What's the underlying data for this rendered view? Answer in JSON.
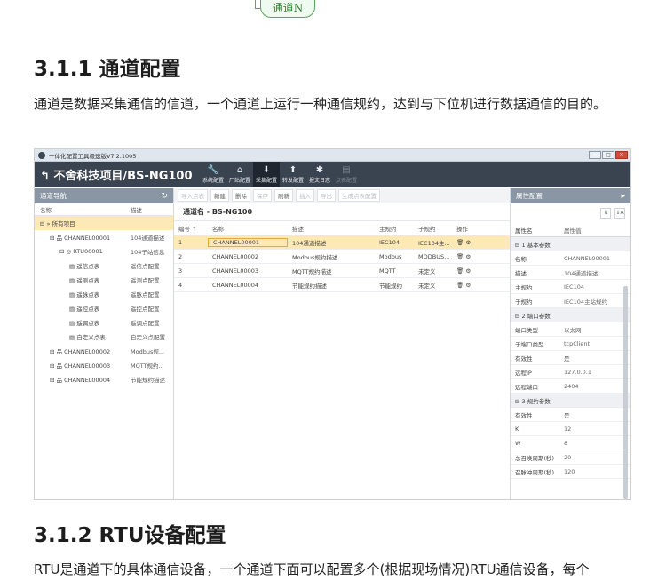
{
  "top_pill": "通道N",
  "sections": {
    "s1_heading": "3.1.1 通道配置",
    "s1_text": "通道是数据采集通信的信道，一个通道上运行一种通信规约，达到与下位机进行数据通信的目的。",
    "s2_heading": "3.1.2 RTU设备配置",
    "s2_text": "RTU是通道下的具体通信设备，一个通道下面可以配置多个(根据现场情况)RTU通信设备，每个"
  },
  "app": {
    "window_title": "一体化配置工具极速版V7.2.1005",
    "project_title": "不舍科技项目/BS-NG100",
    "toolbar": [
      {
        "icon": "wrench-icon",
        "glyph": "🔧",
        "label": "系统配置"
      },
      {
        "icon": "home-icon",
        "glyph": "⌂",
        "label": "厂站配置"
      },
      {
        "icon": "download-icon",
        "glyph": "⬇",
        "label": "采集配置"
      },
      {
        "icon": "upload-icon",
        "glyph": "⬆",
        "label": "转发配置"
      },
      {
        "icon": "bug-icon",
        "glyph": "✱",
        "label": "报文日志"
      },
      {
        "icon": "document-icon",
        "glyph": "▤",
        "label": "点表配置"
      }
    ],
    "left": {
      "panel_title": "通道导航",
      "col_name": "名称",
      "col_desc": "描述",
      "items": [
        {
          "name": "所有项目",
          "desc": "",
          "level": 0
        },
        {
          "name": "CHANNEL00001",
          "desc": "104通道描述",
          "level": 1
        },
        {
          "name": "RTU00001",
          "desc": "104子站信息",
          "level": 2
        },
        {
          "name": "遥信点表",
          "desc": "遥信点配置",
          "level": 3
        },
        {
          "name": "遥测点表",
          "desc": "遥测点配置",
          "level": 3
        },
        {
          "name": "遥脉点表",
          "desc": "遥脉点配置",
          "level": 3
        },
        {
          "name": "遥控点表",
          "desc": "遥控点配置",
          "level": 3
        },
        {
          "name": "遥调点表",
          "desc": "遥调点配置",
          "level": 3
        },
        {
          "name": "自定义点表",
          "desc": "自定义点配置",
          "level": 3
        },
        {
          "name": "CHANNEL00002",
          "desc": "Modbus规...",
          "level": 1
        },
        {
          "name": "CHANNEL00003",
          "desc": "MQTT规约...",
          "level": 1
        },
        {
          "name": "CHANNEL00004",
          "desc": "节能规约描述",
          "level": 1
        }
      ]
    },
    "mid": {
      "tools": [
        "导入点表",
        "新建",
        "删除",
        "保存",
        "刷新",
        "插入",
        "导出",
        "生成点表配置"
      ],
      "channel_name": "通道名 - BS-NG100",
      "headers": [
        "编号 ↑",
        "名称",
        "描述",
        "主规约",
        "子规约",
        "操作"
      ],
      "rows": [
        [
          "1",
          "CHANNEL00001",
          "104通道描述",
          "IEC104",
          "IEC104主...",
          "🗑 ⚙"
        ],
        [
          "2",
          "CHANNEL00002",
          "Modbus规约描述",
          "Modbus",
          "MODBUS...",
          "🗑 ⚙"
        ],
        [
          "3",
          "CHANNEL00003",
          "MQTT规约描述",
          "MQTT",
          "未定义",
          "🗑 ⚙"
        ],
        [
          "4",
          "CHANNEL00004",
          "节能规约描述",
          "节能规约",
          "未定义",
          "🗑 ⚙"
        ]
      ]
    },
    "right": {
      "panel_title": "属性配置",
      "col_name": "属性名",
      "col_value": "属性值",
      "rows": [
        {
          "group": "1 基本参数"
        },
        {
          "k": "名称",
          "v": "CHANNEL00001"
        },
        {
          "k": "描述",
          "v": "104通道描述"
        },
        {
          "k": "主规约",
          "v": "IEC104"
        },
        {
          "k": "子规约",
          "v": "IEC104主站规约"
        },
        {
          "group": "2 端口参数"
        },
        {
          "k": "端口类型",
          "v": "以太网"
        },
        {
          "k": "子端口类型",
          "v": "tcpClient"
        },
        {
          "k": "有效性",
          "v": "是"
        },
        {
          "k": "远程IP",
          "v": "127.0.0.1"
        },
        {
          "k": "远程端口",
          "v": "2404"
        },
        {
          "group": "3 规约参数"
        },
        {
          "k": "有效性",
          "v": "是"
        },
        {
          "k": "K",
          "v": "12"
        },
        {
          "k": "W",
          "v": "8"
        },
        {
          "k": "总召唤周期(秒)",
          "v": "20"
        },
        {
          "k": "召脉冲周期(秒)",
          "v": "120"
        }
      ]
    }
  }
}
